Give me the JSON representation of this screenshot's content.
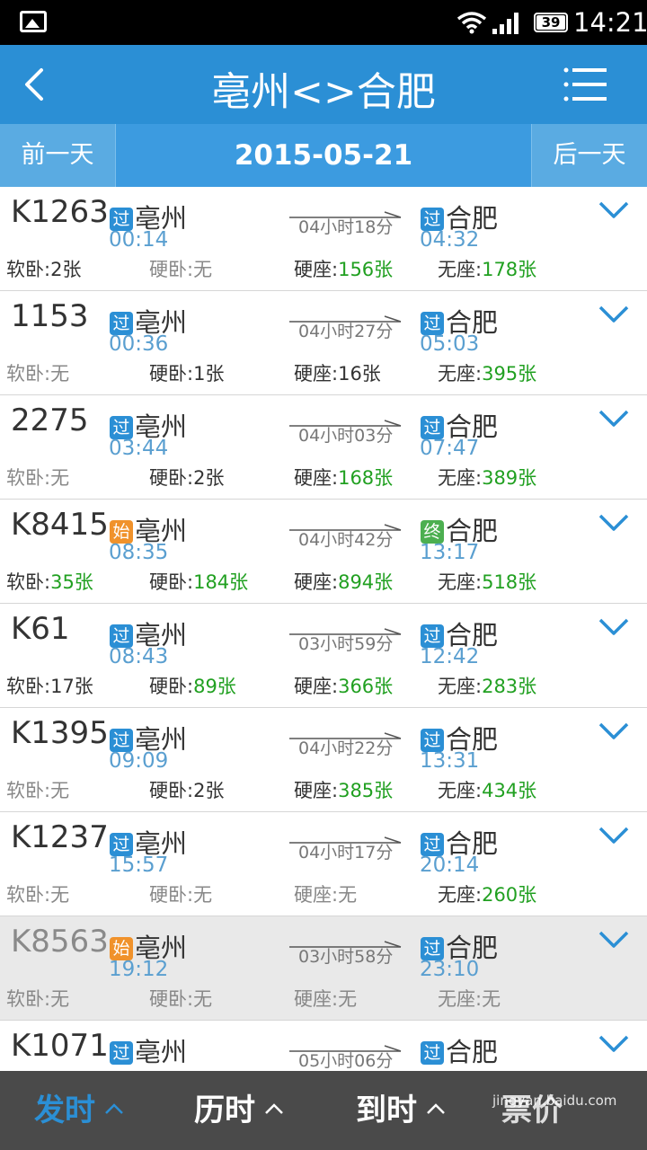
{
  "status": {
    "battery": "39",
    "time": "14:21"
  },
  "header": {
    "title": "亳州<>合肥"
  },
  "datebar": {
    "prev": "前一天",
    "date": "2015-05-21",
    "next": "后一天"
  },
  "trains": [
    {
      "num": "K1263",
      "from": "亳州",
      "from_badge": "过",
      "from_badge_type": "pass",
      "dep": "00:14",
      "duration": "04小时18分",
      "to": "合肥",
      "to_badge": "过",
      "to_badge_type": "pass",
      "arr": "04:32",
      "seats": [
        {
          "label": "软卧:",
          "value": "2张",
          "ok": false
        },
        {
          "label": "硬卧:",
          "value": "无",
          "ok": false,
          "none": true
        },
        {
          "label": "硬座:",
          "value": "156张",
          "ok": true
        },
        {
          "label": "无座:",
          "value": "178张",
          "ok": true
        }
      ]
    },
    {
      "num": "1153",
      "from": "亳州",
      "from_badge": "过",
      "from_badge_type": "pass",
      "dep": "00:36",
      "duration": "04小时27分",
      "to": "合肥",
      "to_badge": "过",
      "to_badge_type": "pass",
      "arr": "05:03",
      "seats": [
        {
          "label": "软卧:",
          "value": "无",
          "ok": false,
          "none": true
        },
        {
          "label": "硬卧:",
          "value": "1张",
          "ok": false
        },
        {
          "label": "硬座:",
          "value": "16张",
          "ok": false
        },
        {
          "label": "无座:",
          "value": "395张",
          "ok": true
        }
      ]
    },
    {
      "num": "2275",
      "from": "亳州",
      "from_badge": "过",
      "from_badge_type": "pass",
      "dep": "03:44",
      "duration": "04小时03分",
      "to": "合肥",
      "to_badge": "过",
      "to_badge_type": "pass",
      "arr": "07:47",
      "seats": [
        {
          "label": "软卧:",
          "value": "无",
          "ok": false,
          "none": true
        },
        {
          "label": "硬卧:",
          "value": "2张",
          "ok": false
        },
        {
          "label": "硬座:",
          "value": "168张",
          "ok": true
        },
        {
          "label": "无座:",
          "value": "389张",
          "ok": true
        }
      ]
    },
    {
      "num": "K8415",
      "from": "亳州",
      "from_badge": "始",
      "from_badge_type": "start",
      "dep": "08:35",
      "duration": "04小时42分",
      "to": "合肥",
      "to_badge": "终",
      "to_badge_type": "end",
      "arr": "13:17",
      "seats": [
        {
          "label": "软卧:",
          "value": "35张",
          "ok": true
        },
        {
          "label": "硬卧:",
          "value": "184张",
          "ok": true
        },
        {
          "label": "硬座:",
          "value": "894张",
          "ok": true
        },
        {
          "label": "无座:",
          "value": "518张",
          "ok": true
        }
      ]
    },
    {
      "num": "K61",
      "from": "亳州",
      "from_badge": "过",
      "from_badge_type": "pass",
      "dep": "08:43",
      "duration": "03小时59分",
      "to": "合肥",
      "to_badge": "过",
      "to_badge_type": "pass",
      "arr": "12:42",
      "seats": [
        {
          "label": "软卧:",
          "value": "17张",
          "ok": false
        },
        {
          "label": "硬卧:",
          "value": "89张",
          "ok": true
        },
        {
          "label": "硬座:",
          "value": "366张",
          "ok": true
        },
        {
          "label": "无座:",
          "value": "283张",
          "ok": true
        }
      ]
    },
    {
      "num": "K1395",
      "from": "亳州",
      "from_badge": "过",
      "from_badge_type": "pass",
      "dep": "09:09",
      "duration": "04小时22分",
      "to": "合肥",
      "to_badge": "过",
      "to_badge_type": "pass",
      "arr": "13:31",
      "seats": [
        {
          "label": "软卧:",
          "value": "无",
          "ok": false,
          "none": true
        },
        {
          "label": "硬卧:",
          "value": "2张",
          "ok": false
        },
        {
          "label": "硬座:",
          "value": "385张",
          "ok": true
        },
        {
          "label": "无座:",
          "value": "434张",
          "ok": true
        }
      ]
    },
    {
      "num": "K1237",
      "from": "亳州",
      "from_badge": "过",
      "from_badge_type": "pass",
      "dep": "15:57",
      "duration": "04小时17分",
      "to": "合肥",
      "to_badge": "过",
      "to_badge_type": "pass",
      "arr": "20:14",
      "seats": [
        {
          "label": "软卧:",
          "value": "无",
          "ok": false,
          "none": true
        },
        {
          "label": "硬卧:",
          "value": "无",
          "ok": false,
          "none": true
        },
        {
          "label": "硬座:",
          "value": "无",
          "ok": false,
          "none": true
        },
        {
          "label": "无座:",
          "value": "260张",
          "ok": true
        }
      ]
    },
    {
      "num": "K8563",
      "from": "亳州",
      "from_badge": "始",
      "from_badge_type": "start",
      "dep": "19:12",
      "duration": "03小时58分",
      "to": "合肥",
      "to_badge": "过",
      "to_badge_type": "pass",
      "arr": "23:10",
      "gray": true,
      "seats": [
        {
          "label": "软卧:",
          "value": "无",
          "ok": false,
          "none": true
        },
        {
          "label": "硬卧:",
          "value": "无",
          "ok": false,
          "none": true
        },
        {
          "label": "硬座:",
          "value": "无",
          "ok": false,
          "none": true
        },
        {
          "label": "无座:",
          "value": "无",
          "ok": false,
          "none": true
        }
      ]
    },
    {
      "num": "K1071",
      "from": "亳州",
      "from_badge": "过",
      "from_badge_type": "pass",
      "dep": "",
      "duration": "05小时06分",
      "to": "合肥",
      "to_badge": "过",
      "to_badge_type": "pass",
      "arr": "",
      "seats": []
    }
  ],
  "bottom": {
    "sort_depart": "发时",
    "sort_duration": "历时",
    "sort_arrive": "到时",
    "sort_price": "票价",
    "watermark": "jingyan.baidu.com"
  },
  "colors": {
    "primary": "#2b8fd5",
    "available": "#21a021",
    "time": "#5a9fd0"
  }
}
